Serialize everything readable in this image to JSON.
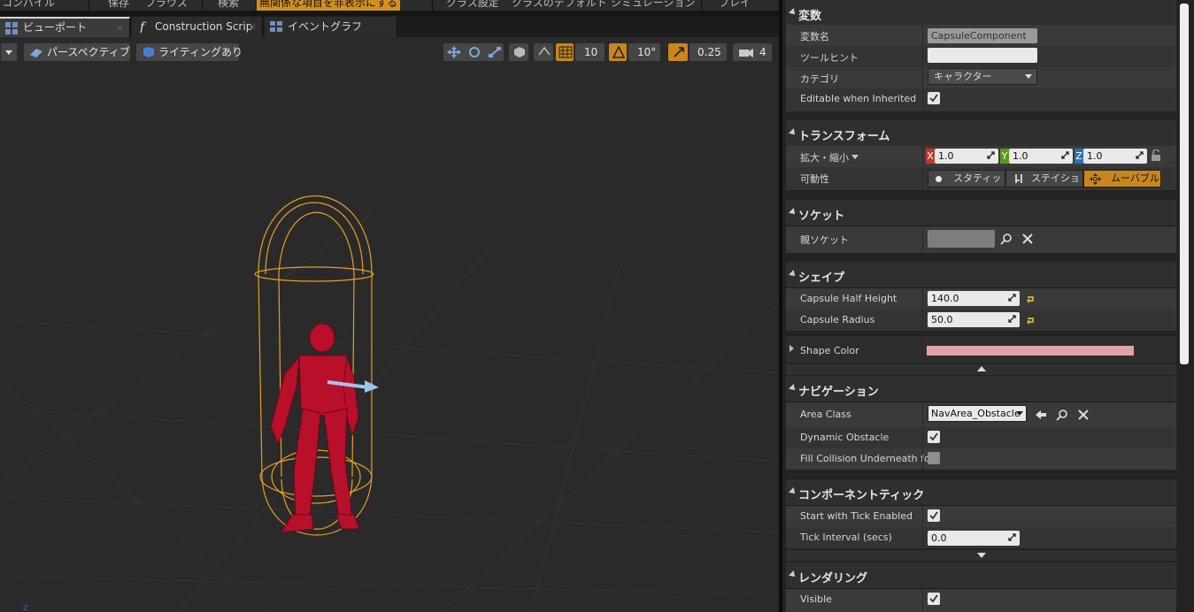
{
  "menubar": {
    "items": [
      "コンパイル",
      "保存",
      "ブラウズ",
      "検索",
      "無関係な項目を非表示にする",
      "クラス設定",
      "クラスのデフォルト",
      "シミュレーション",
      "プレイ"
    ]
  },
  "tabs": [
    {
      "label": "ビューポート",
      "close": "×",
      "active": true
    },
    {
      "label": "Construction Scrip",
      "close": "×",
      "active": false
    },
    {
      "label": "イベントグラフ",
      "close": "×",
      "active": false
    }
  ],
  "viewport_toolbar": {
    "perspective": "パースペクティブ",
    "lighting": "ライティングあり",
    "grid_snap": "10",
    "rotation_snap": "10°",
    "scale_snap": "0.25",
    "camera_speed": "4"
  },
  "details": {
    "sections": {
      "variable": "変数",
      "transform": "トランスフォーム",
      "sockets": "ソケット",
      "shape": "シェイプ",
      "navigation": "ナビゲーション",
      "component_tick": "コンポーネントティック",
      "rendering": "レンダリング"
    },
    "variable": {
      "name_label": "変数名",
      "name_value": "CapsuleComponent",
      "tooltip_label": "ツールヒント",
      "tooltip_value": "",
      "category_label": "カテゴリ",
      "category_value": "キャラクター",
      "editable_label": "Editable when Inherited",
      "editable_checked": true
    },
    "transform": {
      "scale_label": "拡大・縮小",
      "x": "1.0",
      "y": "1.0",
      "z": "1.0",
      "x_axis": "X",
      "y_axis": "Y",
      "z_axis": "Z",
      "mobility_label": "可動性",
      "mobility_static": "スタティック",
      "mobility_stationary": "ステイショナリ",
      "mobility_movable": "ムーバブル",
      "mobility_selected": "ムーバブル"
    },
    "sockets": {
      "parent_label": "親ソケット",
      "parent_value": ""
    },
    "shape": {
      "half_height_label": "Capsule Half Height",
      "half_height_value": "140.0",
      "radius_label": "Capsule Radius",
      "radius_value": "50.0",
      "color_label": "Shape Color",
      "color_value": "#e0a2a6"
    },
    "navigation": {
      "area_class_label": "Area Class",
      "area_class_value": "NavArea_Obstacle",
      "dynamic_obstacle_label": "Dynamic Obstacle",
      "dynamic_obstacle_checked": true,
      "fill_collision_label": "Fill Collision Underneath for",
      "fill_collision_checked": false
    },
    "tick": {
      "start_label": "Start with Tick Enabled",
      "start_checked": true,
      "interval_label": "Tick Interval (secs)",
      "interval_value": "0.0"
    },
    "rendering": {
      "visible_label": "Visible",
      "visible_checked": true
    }
  },
  "colors": {
    "accent": "#c8861c",
    "axis_x": "#c0392b",
    "axis_y": "#5c9a1a",
    "axis_z": "#2f6fb3",
    "capsule": "#e6a020",
    "character": "#c0102a"
  }
}
